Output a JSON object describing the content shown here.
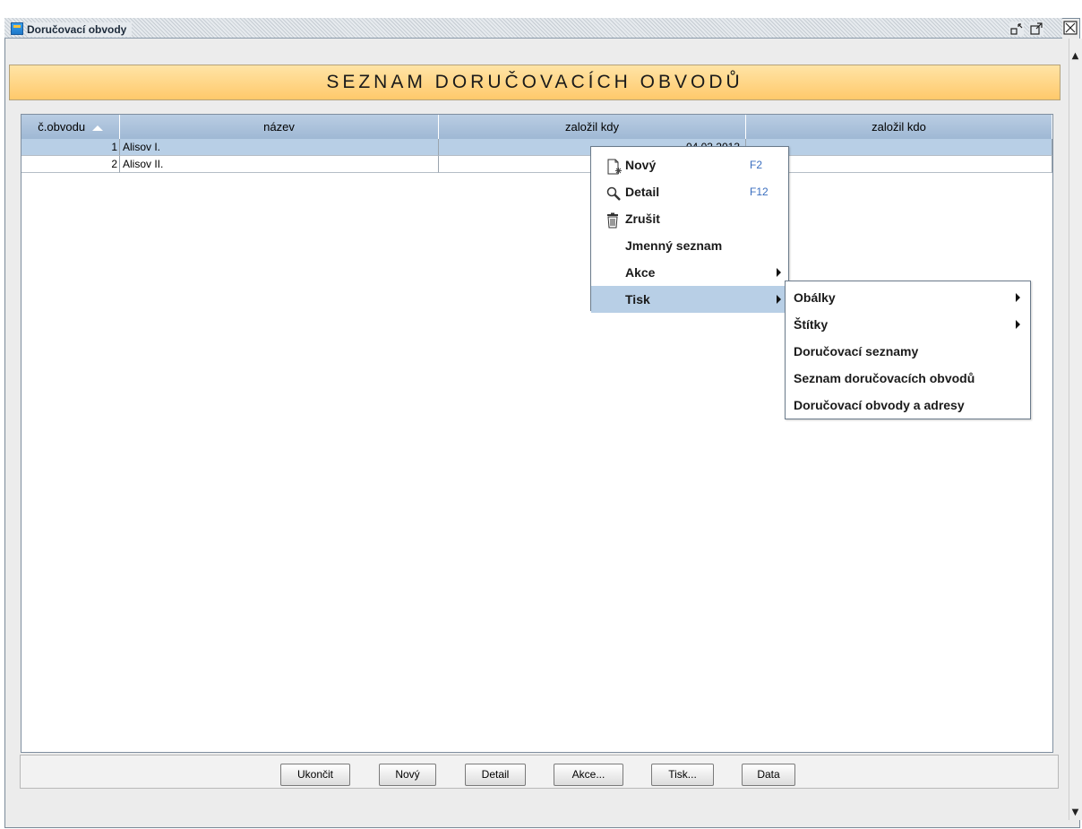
{
  "window": {
    "title": "Doručovací obvody",
    "accent": "#1e78c8"
  },
  "banner": {
    "title": "SEZNAM DORUČOVACÍCH OBVODŮ",
    "color": "#ffc96b"
  },
  "table": {
    "columns": [
      "č.obvodu",
      "název",
      "založil kdy",
      "založil kdo"
    ],
    "sort_column": "č.obvodu",
    "rows": [
      {
        "num": "1",
        "name": "Alisov I.",
        "date": "04.03.2013",
        "by": "",
        "selected": true
      },
      {
        "num": "2",
        "name": "Alisov II.",
        "date": "",
        "by": "",
        "selected": false
      }
    ]
  },
  "context_menu": {
    "items": [
      {
        "label": "Nový",
        "shortcut": "F2",
        "icon": "new-document-icon"
      },
      {
        "label": "Detail",
        "shortcut": "F12",
        "icon": "magnifier-icon"
      },
      {
        "label": "Zrušit",
        "shortcut": "",
        "icon": "trash-icon"
      },
      {
        "label": "Jmenný seznam",
        "shortcut": ""
      },
      {
        "label": "Akce",
        "shortcut": "",
        "submenu": true
      },
      {
        "label": "Tisk",
        "shortcut": "",
        "submenu": true,
        "highlighted": true
      }
    ]
  },
  "submenu_tisk": {
    "items": [
      {
        "label": "Obálky",
        "submenu": true
      },
      {
        "label": "Štítky",
        "submenu": true
      },
      {
        "label": "Doručovací seznamy"
      },
      {
        "label": "Seznam doručovacích obvodů"
      },
      {
        "label": "Doručovací obvody a adresy"
      }
    ]
  },
  "toolbar": {
    "buttons": [
      "Ukončit",
      "Nový",
      "Detail",
      "Akce...",
      "Tisk...",
      "Data"
    ]
  },
  "title_buttons": {
    "minimize": "minimize-icon",
    "maximize": "maximize-icon",
    "close": "close-icon"
  }
}
